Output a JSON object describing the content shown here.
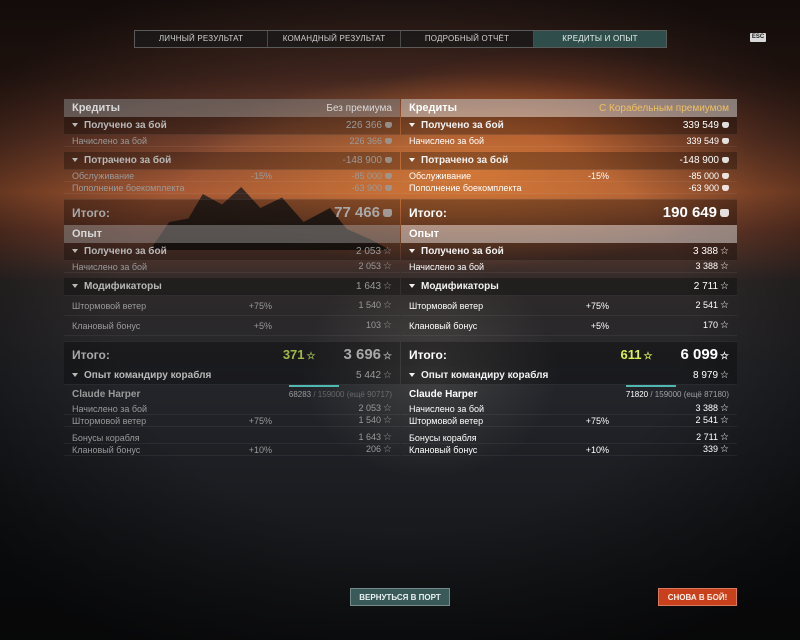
{
  "tabs": [
    {
      "label": "ЛИЧНЫЙ РЕЗУЛЬТАТ",
      "active": false
    },
    {
      "label": "КОМАНДНЫЙ РЕЗУЛЬТАТ",
      "active": false
    },
    {
      "label": "ПОДРОБНЫЙ ОТЧЁТ",
      "active": false
    },
    {
      "label": "КРЕДИТЫ И ОПЫТ",
      "active": true
    }
  ],
  "esc_label": "ESC",
  "left": {
    "credits_title": "Кредиты",
    "credits_subtitle": "Без премиума",
    "earned_label": "Получено за бой",
    "earned_value": "226 366",
    "accrued_label": "Начислено за бой",
    "accrued_value": "226 366",
    "spent_label": "Потрачено за бой",
    "spent_value": "-148 900",
    "service_label": "Обслуживание",
    "service_pct": "-15%",
    "service_value": "-85 000",
    "ammo_label": "Пополнение боекомплекта",
    "ammo_value": "-63 900",
    "total_label": "Итого:",
    "total_value": "77 466",
    "xp_title": "Опыт",
    "xp_earned_label": "Получено за бой",
    "xp_earned_value": "2 053",
    "xp_accrued_label": "Начислено за бой",
    "xp_accrued_value": "2 053",
    "mods_label": "Модификаторы",
    "mods_value": "1 643",
    "storm_label": "Штормовой ветер",
    "storm_pct": "+75%",
    "storm_value": "1 540",
    "clan_label": "Клановый бонус",
    "clan_pct": "+5%",
    "clan_value": "103",
    "xp_total_label": "Итого:",
    "xp_free": "371",
    "xp_total": "3 696",
    "cmdr_label": "Опыт командиру корабля",
    "cmdr_value": "5 442",
    "captain_name": "Claude Harper",
    "captain_xp": "68283",
    "captain_max": "/ 159000 (ещё 90717)",
    "c_accrued_label": "Начислено за бой",
    "c_accrued_value": "2 053",
    "c_storm_label": "Штормовой ветер",
    "c_storm_pct": "+75%",
    "c_storm_value": "1 540",
    "c_ship_label": "Бонусы корабля",
    "c_ship_value": "1 643",
    "c_clan_label": "Клановый бонус",
    "c_clan_pct": "+10%",
    "c_clan_value": "206"
  },
  "right": {
    "credits_title": "Кредиты",
    "credits_subtitle": "С Корабельным премиумом",
    "earned_label": "Получено за бой",
    "earned_value": "339 549",
    "accrued_label": "Начислено за бой",
    "accrued_value": "339 549",
    "spent_label": "Потрачено за бой",
    "spent_value": "-148 900",
    "service_label": "Обслуживание",
    "service_pct": "-15%",
    "service_value": "-85 000",
    "ammo_label": "Пополнение боекомплекта",
    "ammo_value": "-63 900",
    "total_label": "Итого:",
    "total_value": "190 649",
    "xp_title": "Опыт",
    "xp_earned_label": "Получено за бой",
    "xp_earned_value": "3 388",
    "xp_accrued_label": "Начислено за бой",
    "xp_accrued_value": "3 388",
    "mods_label": "Модификаторы",
    "mods_value": "2 711",
    "storm_label": "Штормовой ветер",
    "storm_pct": "+75%",
    "storm_value": "2 541",
    "clan_label": "Клановый бонус",
    "clan_pct": "+5%",
    "clan_value": "170",
    "xp_total_label": "Итого:",
    "xp_free": "611",
    "xp_total": "6 099",
    "cmdr_label": "Опыт командиру корабля",
    "cmdr_value": "8 979",
    "captain_name": "Claude Harper",
    "captain_xp": "71820",
    "captain_max": "/ 159000 (ещё 87180)",
    "c_accrued_label": "Начислено за бой",
    "c_accrued_value": "3 388",
    "c_storm_label": "Штормовой ветер",
    "c_storm_pct": "+75%",
    "c_storm_value": "2 541",
    "c_ship_label": "Бонусы корабля",
    "c_ship_value": "2 711",
    "c_clan_label": "Клановый бонус",
    "c_clan_pct": "+10%",
    "c_clan_value": "339"
  },
  "buttons": {
    "back_to_port": "ВЕРНУТЬСЯ В ПОРТ",
    "battle_again": "СНОВА В БОЙ!"
  },
  "colors": {
    "accent_teal": "#2f4d4a",
    "premium_gold": "#f0c060",
    "free_xp_green": "#d8f050",
    "battle_button": "#c8401c"
  }
}
